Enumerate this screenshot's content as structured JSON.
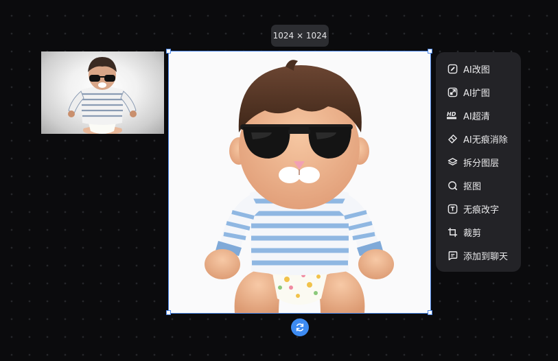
{
  "image": {
    "dimensions_label": "1024 × 1024"
  },
  "context_menu": {
    "items": [
      {
        "label": "AI改图",
        "icon": "ai-edit-icon"
      },
      {
        "label": "AI扩图",
        "icon": "ai-expand-icon"
      },
      {
        "label": "AI超清",
        "icon": "hd-icon"
      },
      {
        "label": "AI无痕消除",
        "icon": "eraser-icon"
      },
      {
        "label": "拆分图层",
        "icon": "layers-icon"
      },
      {
        "label": "抠图",
        "icon": "cutout-icon"
      },
      {
        "label": "无痕改字",
        "icon": "edit-text-icon"
      },
      {
        "label": "裁剪",
        "icon": "crop-icon"
      },
      {
        "label": "添加到聊天",
        "icon": "chat-add-icon"
      }
    ]
  },
  "colors": {
    "background": "#0b0b0d",
    "menu_background": "#232327",
    "selection_accent": "#4a86e8",
    "refresh_button": "#3d8bf2"
  },
  "icons": {
    "refresh": "refresh-icon"
  }
}
